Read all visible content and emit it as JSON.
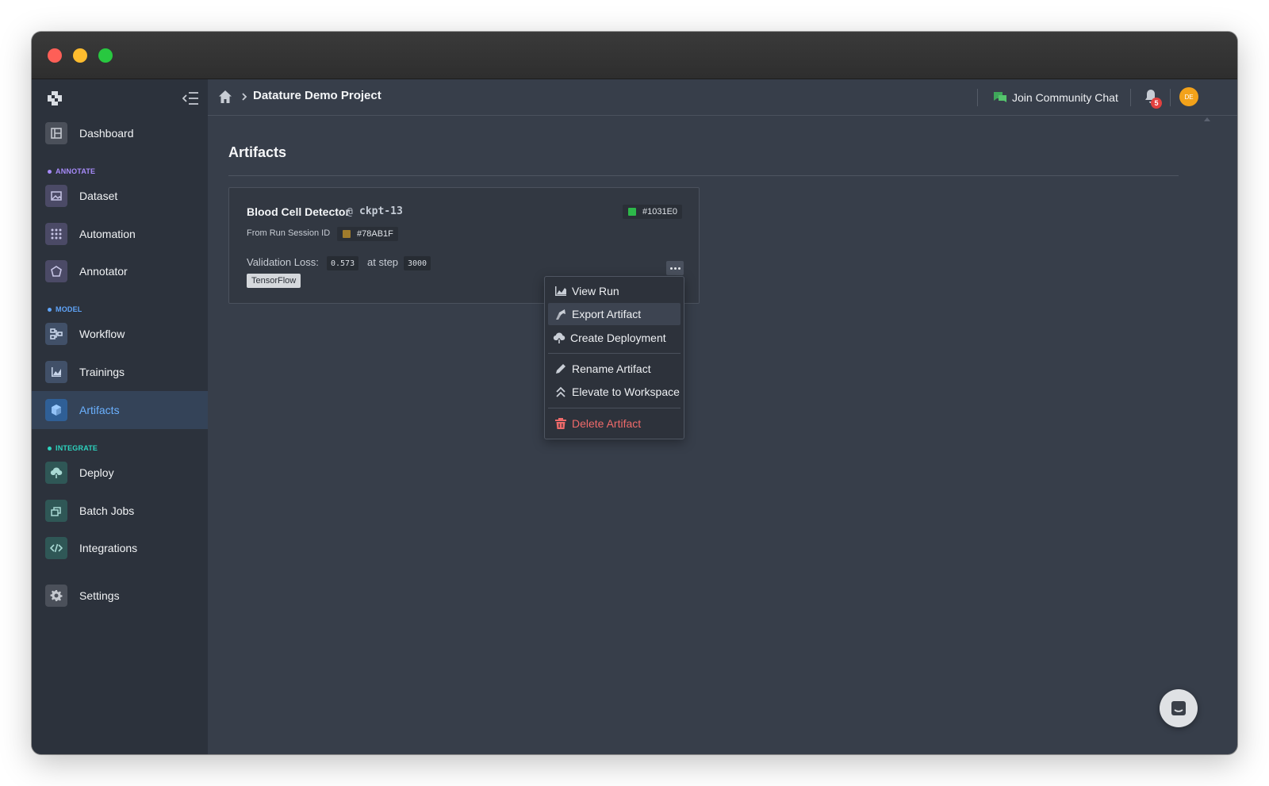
{
  "sidebar": {
    "items": {
      "dashboard": "Dashboard",
      "dataset": "Dataset",
      "automation": "Automation",
      "annotator": "Annotator",
      "workflow": "Workflow",
      "trainings": "Trainings",
      "artifacts": "Artifacts",
      "deploy": "Deploy",
      "batch_jobs": "Batch Jobs",
      "integrations": "Integrations",
      "settings": "Settings"
    },
    "sections": {
      "annotate": "ANNOTATE",
      "model": "MODEL",
      "integrate": "INTEGRATE"
    },
    "section_colors": {
      "annotate": "#a78bfa",
      "model": "#60a5fa",
      "integrate": "#2dd4bf"
    },
    "active": "artifacts"
  },
  "header": {
    "project": "Datature Demo Project",
    "community_chat": "Join Community Chat",
    "notification_count": "5",
    "avatar_initials": "DE"
  },
  "main": {
    "title": "Artifacts"
  },
  "artifact": {
    "name": "Blood Cell Detector",
    "at": "@",
    "checkpoint": "ckpt-13",
    "id": "#1031E0",
    "id_color": "#2db84a",
    "from_label": "From Run Session ID",
    "run_session_id": "#78AB1F",
    "run_color": "#a07c2c",
    "metric_label": "Validation Loss:",
    "metric_value": "0.573",
    "step_label": "at step",
    "step_value": "3000",
    "framework": "TensorFlow"
  },
  "menu": {
    "items": [
      "View Run",
      "Export Artifact",
      "Create Deployment",
      "Rename Artifact",
      "Elevate to Workspace",
      "Delete Artifact"
    ],
    "hovered": "Export Artifact",
    "danger_color": "#ef6a6a"
  }
}
